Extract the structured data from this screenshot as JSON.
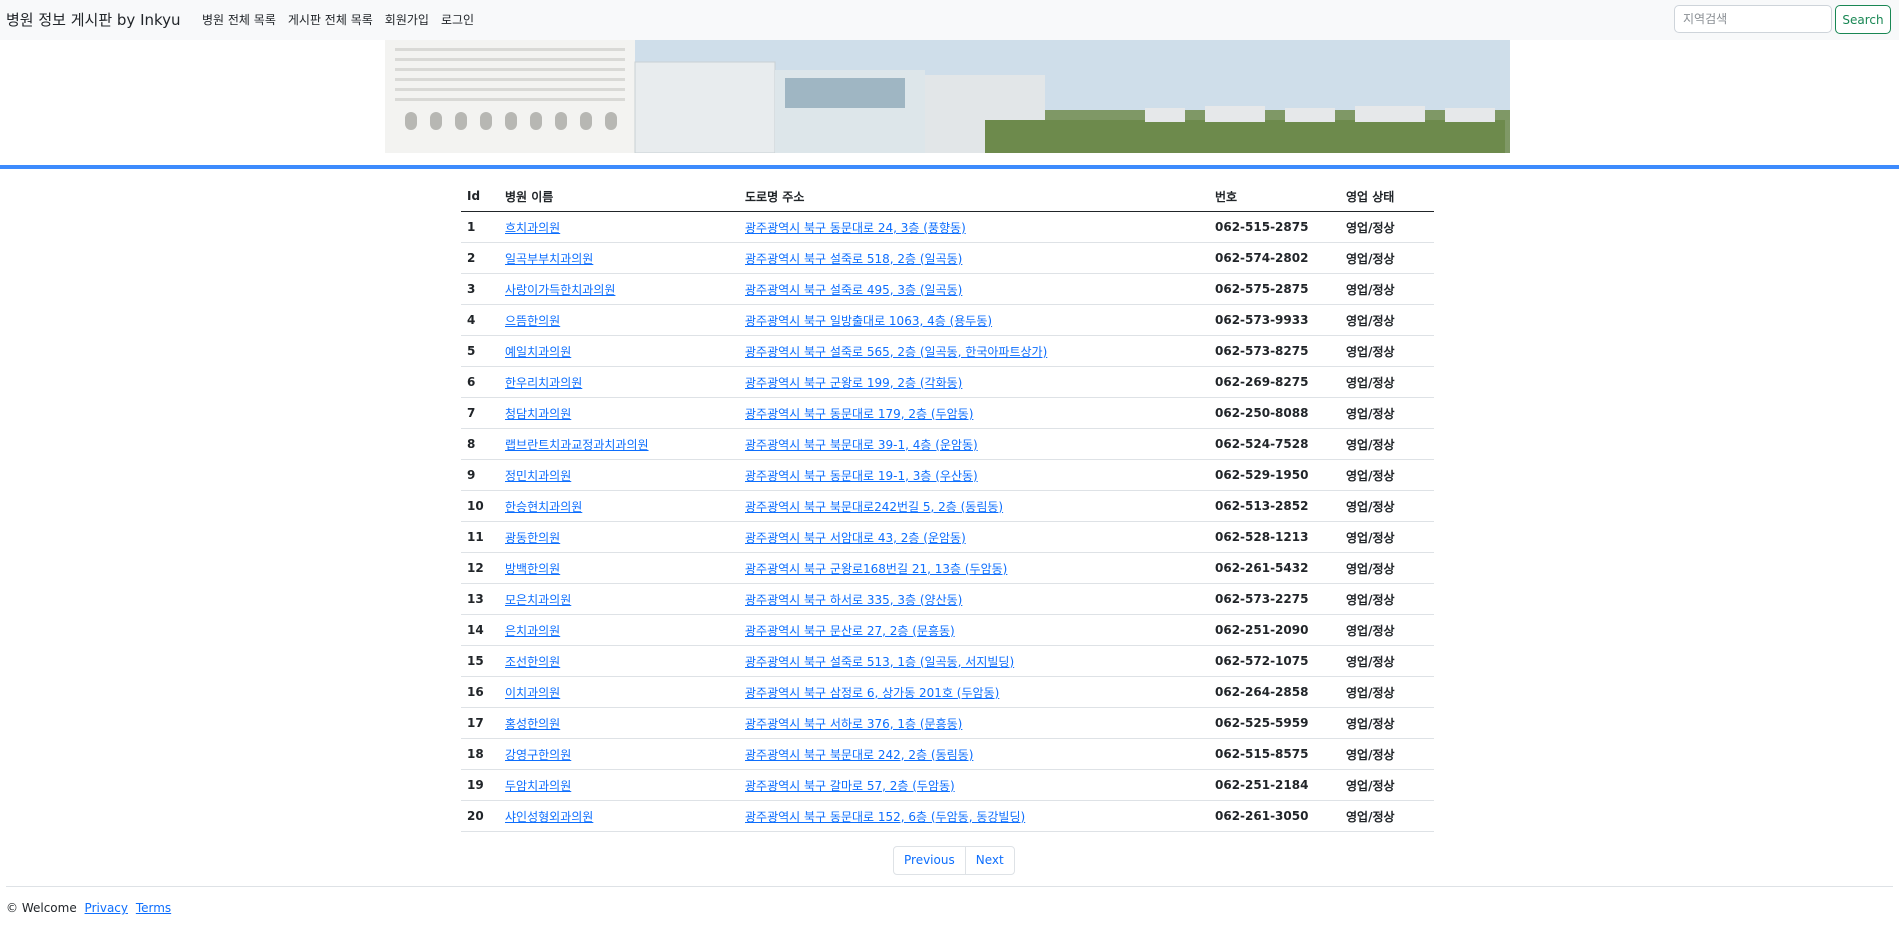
{
  "navbar": {
    "brand": "병원 정보 게시판 by Inkyu",
    "links": [
      "병원 전체 목록",
      "게시판 전체 목록",
      "회원가입",
      "로그인"
    ],
    "search_placeholder": "지역검색",
    "search_button": "Search"
  },
  "table": {
    "headers": [
      "Id",
      "병원 이름",
      "도로명 주소",
      "번호",
      "영업 상태"
    ],
    "rows": [
      {
        "id": "1",
        "name": "흐치과의원",
        "address": "광주광역시 북구 동문대로 24, 3층 (풍향동)",
        "phone": "062-515-2875",
        "status": "영업/정상"
      },
      {
        "id": "2",
        "name": "일곡부부치과의원",
        "address": "광주광역시 북구 설죽로 518, 2층 (일곡동)",
        "phone": "062-574-2802",
        "status": "영업/정상"
      },
      {
        "id": "3",
        "name": "사랑이가득한치과의원",
        "address": "광주광역시 북구 설죽로 495, 3층 (일곡동)",
        "phone": "062-575-2875",
        "status": "영업/정상"
      },
      {
        "id": "4",
        "name": "으뜸한의원",
        "address": "광주광역시 북구 일방출대로 1063, 4층 (용두동)",
        "phone": "062-573-9933",
        "status": "영업/정상"
      },
      {
        "id": "5",
        "name": "예일치과의원",
        "address": "광주광역시 북구 설죽로 565, 2층 (일곡동, 한국아파트상가)",
        "phone": "062-573-8275",
        "status": "영업/정상"
      },
      {
        "id": "6",
        "name": "한우리치과의원",
        "address": "광주광역시 북구 군왕로 199, 2층 (각화동)",
        "phone": "062-269-8275",
        "status": "영업/정상"
      },
      {
        "id": "7",
        "name": "청담치과의원",
        "address": "광주광역시 북구 동문대로 179, 2층 (두암동)",
        "phone": "062-250-8088",
        "status": "영업/정상"
      },
      {
        "id": "8",
        "name": "랩브란트치과교정과치과의원",
        "address": "광주광역시 북구 북문대로 39-1, 4층 (운암동)",
        "phone": "062-524-7528",
        "status": "영업/정상"
      },
      {
        "id": "9",
        "name": "정민치과의원",
        "address": "광주광역시 북구 동문대로 19-1, 3층 (우산동)",
        "phone": "062-529-1950",
        "status": "영업/정상"
      },
      {
        "id": "10",
        "name": "한승현치과의원",
        "address": "광주광역시 북구 북문대로242번길 5, 2층 (동림동)",
        "phone": "062-513-2852",
        "status": "영업/정상"
      },
      {
        "id": "11",
        "name": "광동한의원",
        "address": "광주광역시 북구 서암대로 43, 2층 (운암동)",
        "phone": "062-528-1213",
        "status": "영업/정상"
      },
      {
        "id": "12",
        "name": "방백한의원",
        "address": "광주광역시 북구 군왕로168번길 21, 13층 (두암동)",
        "phone": "062-261-5432",
        "status": "영업/정상"
      },
      {
        "id": "13",
        "name": "모은치과의원",
        "address": "광주광역시 북구 하서로 335, 3층 (양산동)",
        "phone": "062-573-2275",
        "status": "영업/정상"
      },
      {
        "id": "14",
        "name": "은치과의원",
        "address": "광주광역시 북구 문산로 27, 2층 (문흥동)",
        "phone": "062-251-2090",
        "status": "영업/정상"
      },
      {
        "id": "15",
        "name": "조선한의원",
        "address": "광주광역시 북구 설죽로 513, 1층 (일곡동, 서지빌딩)",
        "phone": "062-572-1075",
        "status": "영업/정상"
      },
      {
        "id": "16",
        "name": "이치과의원",
        "address": "광주광역시 북구 삼정로 6, 상가동 201호 (두암동)",
        "phone": "062-264-2858",
        "status": "영업/정상"
      },
      {
        "id": "17",
        "name": "홍성한의원",
        "address": "광주광역시 북구 서하로 376, 1층 (문흥동)",
        "phone": "062-525-5959",
        "status": "영업/정상"
      },
      {
        "id": "18",
        "name": "강영구한의원",
        "address": "광주광역시 북구 북문대로 242, 2층 (동림동)",
        "phone": "062-515-8575",
        "status": "영업/정상"
      },
      {
        "id": "19",
        "name": "두암치과의원",
        "address": "광주광역시 북구 갈마로 57, 2층 (두암동)",
        "phone": "062-251-2184",
        "status": "영업/정상"
      },
      {
        "id": "20",
        "name": "샤인성형외과의원",
        "address": "광주광역시 북구 동문대로 152, 6층 (두암동, 동강빌딩)",
        "phone": "062-261-3050",
        "status": "영업/정상"
      }
    ]
  },
  "pagination": {
    "previous": "Previous",
    "next": "Next"
  },
  "footer": {
    "text": "© Welcome",
    "privacy": "Privacy",
    "terms": "Terms"
  },
  "colors": {
    "link": "#0d6efd",
    "divider": "#3d8bfd",
    "search_button": "#198754"
  }
}
